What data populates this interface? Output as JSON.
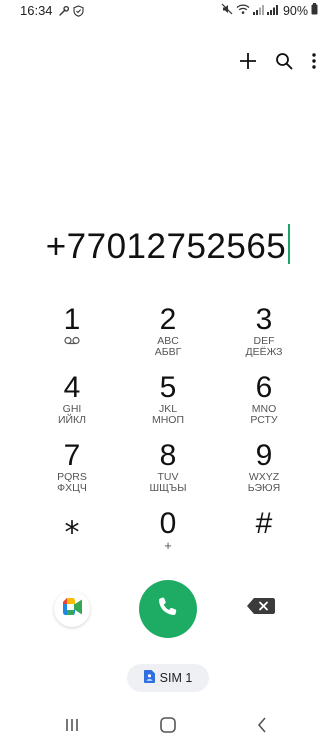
{
  "status_bar": {
    "time": "16:34",
    "battery_percent": "90%",
    "left_icons": [
      "wrench-icon",
      "shield-check-icon"
    ],
    "right_icons": [
      "mute-icon",
      "wifi-icon",
      "signal-icon",
      "signal-icon",
      "battery-icon"
    ]
  },
  "toolbar": {
    "actions": [
      "add-icon",
      "search-icon",
      "more-options-icon"
    ]
  },
  "dialer": {
    "number": "+77012752565"
  },
  "keypad": {
    "keys": [
      {
        "digit": "1",
        "letters": "",
        "letters_ru": "",
        "icon": "voicemail-icon"
      },
      {
        "digit": "2",
        "letters": "ABC",
        "letters_ru": "АБВГ"
      },
      {
        "digit": "3",
        "letters": "DEF",
        "letters_ru": "ДЕЁЖЗ"
      },
      {
        "digit": "4",
        "letters": "GHI",
        "letters_ru": "ИЙКЛ"
      },
      {
        "digit": "5",
        "letters": "JKL",
        "letters_ru": "МНОП"
      },
      {
        "digit": "6",
        "letters": "MNO",
        "letters_ru": "РСТУ"
      },
      {
        "digit": "7",
        "letters": "PQRS",
        "letters_ru": "ФХЦЧ"
      },
      {
        "digit": "8",
        "letters": "TUV",
        "letters_ru": "ШЩЪЫ"
      },
      {
        "digit": "9",
        "letters": "WXYZ",
        "letters_ru": "ЬЭЮЯ"
      },
      {
        "digit": "⁎",
        "letters": "",
        "letters_ru": ""
      },
      {
        "digit": "0",
        "letters": "+",
        "letters_ru": ""
      },
      {
        "digit": "#",
        "letters": "",
        "letters_ru": ""
      }
    ]
  },
  "actions": {
    "sim_label": "SIM 1",
    "call_color": "#1eab63",
    "meet_icon": "google-meet-icon",
    "backspace_icon": "backspace-icon"
  },
  "nav": {
    "buttons": [
      "recents-icon",
      "home-icon",
      "back-icon"
    ]
  }
}
